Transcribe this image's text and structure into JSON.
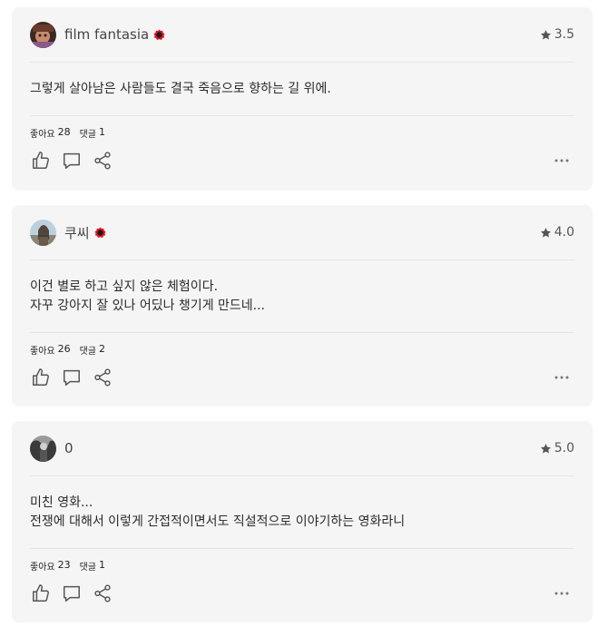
{
  "reviews": [
    {
      "username": "film fantasia",
      "rating": "3.5",
      "text": "그렇게 살아남은 사람들도 결국 죽음으로 향하는 길 위에.",
      "likes_label": "좋아요",
      "likes_count": "28",
      "comments_label": "댓글",
      "comments_count": "1"
    },
    {
      "username": "쿠씨",
      "rating": "4.0",
      "text": "이건 별로 하고 싶지 않은 체험이다.\n자꾸 강아지 잘 있나 어딨나 챙기게 만드네...",
      "likes_label": "좋아요",
      "likes_count": "26",
      "comments_label": "댓글",
      "comments_count": "2"
    },
    {
      "username": "0",
      "rating": "5.0",
      "text": "미친 영화...\n전쟁에 대해서 이렇게 간접적이면서도 직설적으로 이야기하는 영화라니",
      "likes_label": "좋아요",
      "likes_count": "23",
      "comments_label": "댓글",
      "comments_count": "1"
    }
  ],
  "colors": {
    "card_bg": "#f5f5f5",
    "badge_red": "#e8132a",
    "icon_gray": "#555555"
  },
  "icons": {
    "rating": "star-icon",
    "badge": "verified-badge-icon",
    "like": "thumbs-up-icon",
    "comment": "comment-icon",
    "share": "share-icon",
    "more": "more-icon"
  }
}
